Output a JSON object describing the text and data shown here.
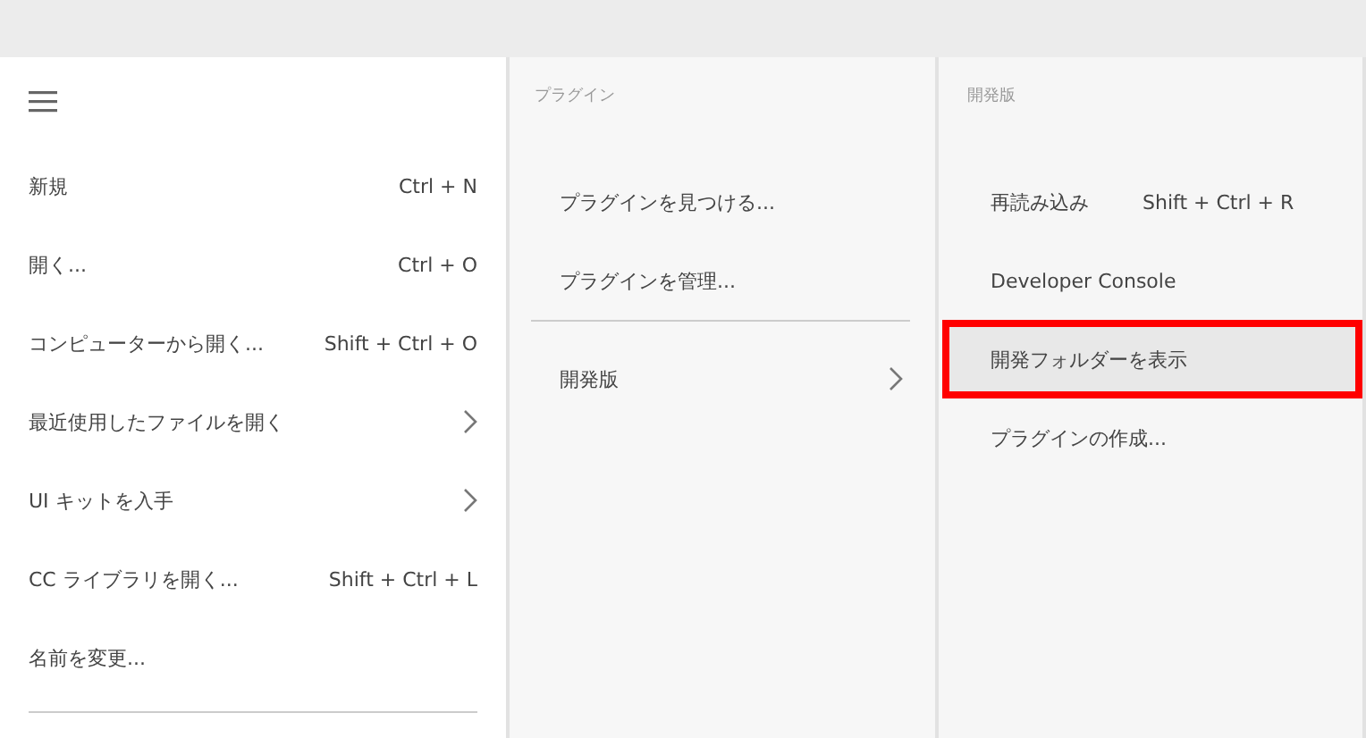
{
  "main_menu": {
    "items": [
      {
        "kind": "item",
        "label": "新規",
        "shortcut": "Ctrl + N"
      },
      {
        "kind": "item",
        "label": "開く...",
        "shortcut": "Ctrl + O"
      },
      {
        "kind": "item",
        "label": "コンピューターから開く...",
        "shortcut": "Shift + Ctrl + O"
      },
      {
        "kind": "submenu",
        "label": "最近使用したファイルを開く"
      },
      {
        "kind": "submenu",
        "label": "UI キットを入手"
      },
      {
        "kind": "item",
        "label": "CC ライブラリを開く...",
        "shortcut": "Shift + Ctrl + L"
      },
      {
        "kind": "item",
        "label": "名前を変更..."
      },
      {
        "kind": "separator"
      }
    ]
  },
  "plugins_menu": {
    "header": "プラグイン",
    "items": [
      {
        "kind": "item",
        "label": "プラグインを見つける..."
      },
      {
        "kind": "item",
        "label": "プラグインを管理..."
      },
      {
        "kind": "separator"
      },
      {
        "kind": "submenu",
        "label": "開発版"
      }
    ]
  },
  "development_menu": {
    "header": "開発版",
    "items": [
      {
        "kind": "item",
        "label": "再読み込み",
        "shortcut": "Shift + Ctrl + R",
        "selected": false
      },
      {
        "kind": "item",
        "label": "Developer Console",
        "selected": false
      },
      {
        "kind": "item",
        "label": "開発フォルダーを表示",
        "selected": true
      },
      {
        "kind": "item",
        "label": "プラグインの作成...",
        "selected": false
      }
    ]
  }
}
